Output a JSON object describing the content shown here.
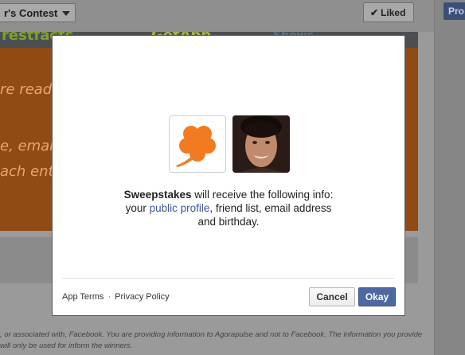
{
  "background": {
    "contest_dropdown": "r's Contest",
    "liked_button": "Liked",
    "promote_button": "Pro",
    "banner": {
      "logos": [
        "restfacts",
        "GetApp",
        "Shows"
      ],
      "lines": [
        "re ready, j",
        "e, email a",
        "ach entry"
      ]
    },
    "footer_text": ", or associated with, Facebook. You are providing information to Agorapulse and not to Facebook. The information you provide will only be used for inform the winners."
  },
  "dialog": {
    "app_icon": "clover-icon",
    "avatar": "user-avatar",
    "info": {
      "app_name": "Sweepstakes",
      "line1_rest": " will receive the following info:",
      "line2_prefix": "your ",
      "public_profile_link": "public profile",
      "line2_rest": ", friend list, email address",
      "line3": "and birthday."
    },
    "footer": {
      "app_terms": "App Terms",
      "separator": "·",
      "privacy_policy": "Privacy Policy"
    },
    "buttons": {
      "cancel": "Cancel",
      "okay": "Okay"
    }
  },
  "colors": {
    "accent": "#3b5998",
    "okay_button": "#4e69a2",
    "clover": "#f27b22"
  }
}
